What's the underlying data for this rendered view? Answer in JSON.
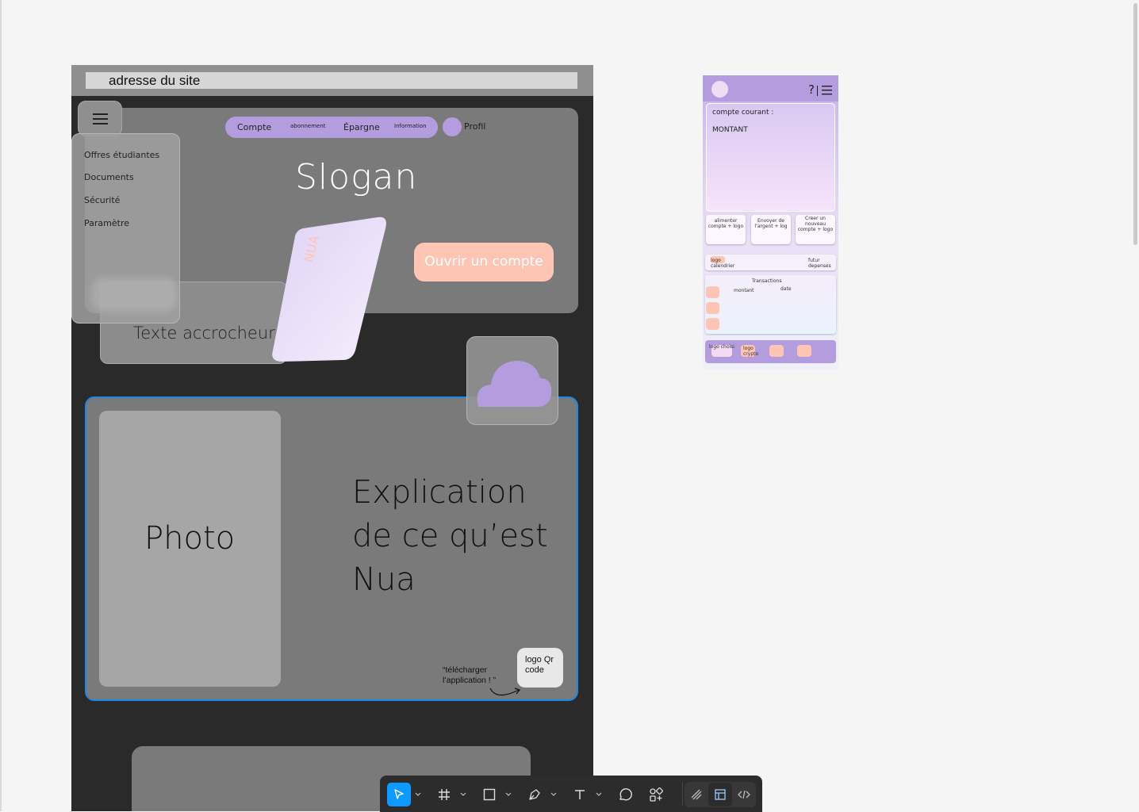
{
  "browser": {
    "url_placeholder": "adresse du site"
  },
  "nav": {
    "items": [
      {
        "label": "Compte"
      },
      {
        "label": "abonnement"
      },
      {
        "label": "Épargne"
      },
      {
        "label": "Information"
      }
    ],
    "profile_label": "Profil"
  },
  "menu": {
    "items": [
      "Offres étudiantes",
      "Documents",
      "Sécurité",
      "Paramètre"
    ]
  },
  "hero": {
    "slogan": "Slogan",
    "cta": "Ouvrir un compte",
    "card_brand": "NUA",
    "catchphrase": "Texte accrocheur"
  },
  "about": {
    "photo": "Photo",
    "explanation": "Explication de ce qu’est Nua",
    "download_note": "“télécharger l’application ! ”",
    "qr": "logo Qr code"
  },
  "mobile": {
    "help": "?",
    "account_label": "compte courant :",
    "amount": "MONTANT",
    "actions": [
      "alimenter compte + logo",
      "Envoyer de l’argent + log",
      "Creer un nouveau compte + logo"
    ],
    "row_left": "logo calendrier",
    "row_right": "futur depenses",
    "transactions_title": "Transactions",
    "col_amount": "montant",
    "col_date": "date",
    "nav_left": "logo choisi",
    "nav_crypto": "logo crypto"
  },
  "colors": {
    "accent_purple": "#b49ddf",
    "accent_peach": "#ffc5b4",
    "selection_blue": "#1e88e5",
    "toolbar_active": "#0d99ff"
  },
  "toolbar": {
    "tools": [
      "move-icon",
      "frame-icon",
      "rectangle-icon",
      "pen-icon",
      "text-icon",
      "comment-icon",
      "actions-icon"
    ],
    "modes": [
      "draw-mode-icon",
      "design-mode-icon",
      "dev-mode-icon"
    ]
  }
}
